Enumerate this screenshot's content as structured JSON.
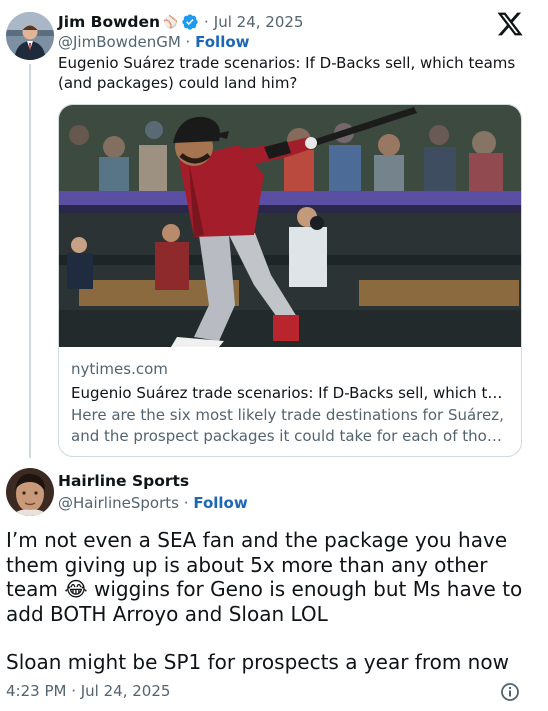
{
  "parent_tweet": {
    "author_name": "Jim Bowden",
    "name_emoji": "⚾",
    "separator": "·",
    "date": "Jul 24, 2025",
    "handle": "@JimBowdenGM",
    "handle_separator": "·",
    "follow_label": "Follow",
    "text": "Eugenio Suárez trade scenarios: If D-Backs sell, which teams (and packages) could land him?",
    "verified_color": "#1d9bf0"
  },
  "link_card": {
    "domain": "nytimes.com",
    "title": "Eugenio Suárez trade scenarios: If D-Backs sell, which teams (and packages) could land him?",
    "description_line1": "Here are the six most likely trade destinations for Suárez,",
    "description_line2": "and the prospect packages it could take for each of those teams."
  },
  "reply_tweet": {
    "author_name": "Hairline Sports",
    "handle": "@HairlineSports",
    "handle_separator": "·",
    "follow_label": "Follow",
    "paragraph1": "I’m not even a SEA fan and the package you have them giving up is about 5x more than any other team 😂 wiggins for Geno is enough but Ms have to add BOTH Arroyo and Sloan LOL",
    "paragraph2": "Sloan might be SP1 for prospects a year from now",
    "timestamp": "4:23 PM · Jul 24, 2025"
  },
  "icons": {
    "logo": "x-logo-icon",
    "verified": "verified-badge-icon",
    "info": "info-icon"
  },
  "colors": {
    "text_primary": "#0f1419",
    "text_secondary": "#536471",
    "link": "#1d67b4",
    "border": "#cfd9de"
  }
}
